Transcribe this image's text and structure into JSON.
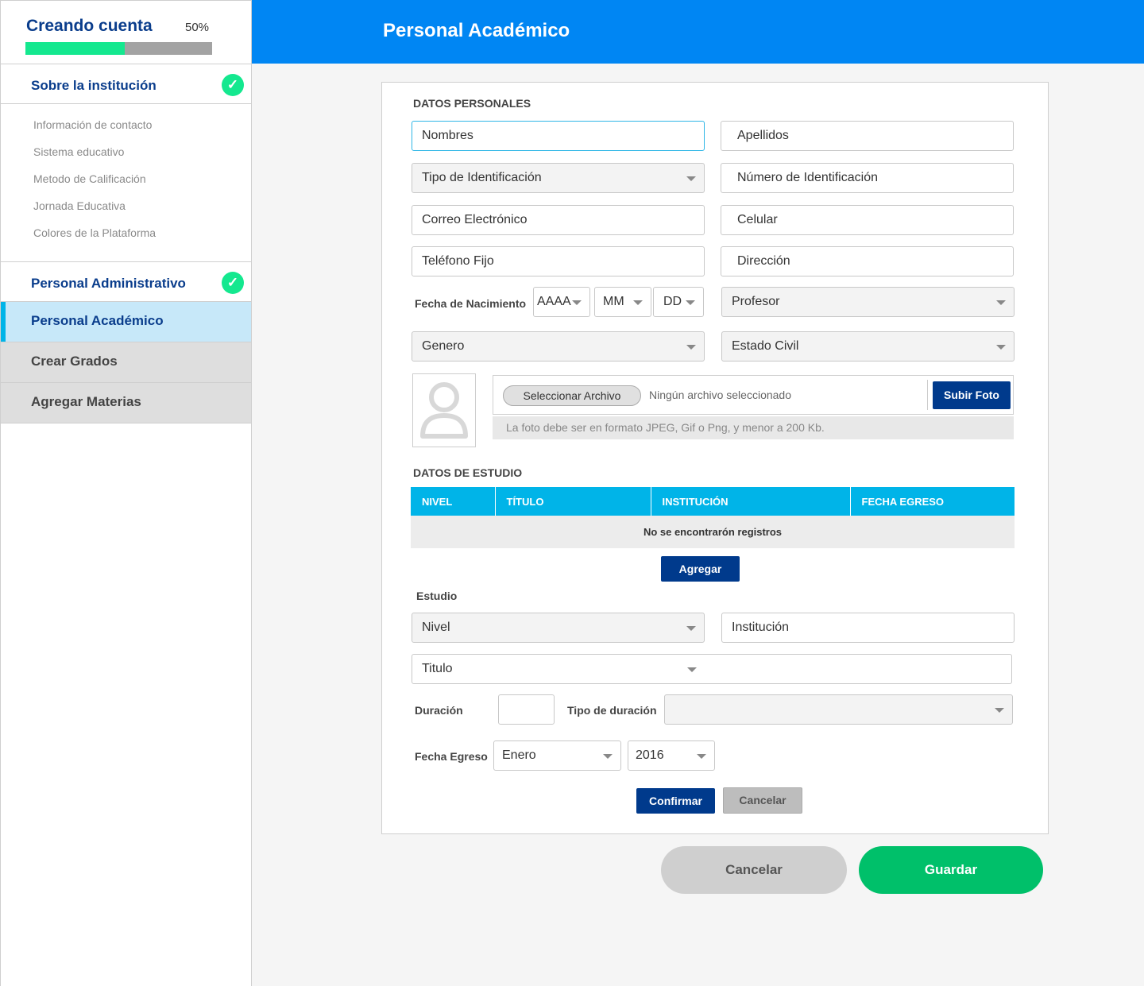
{
  "sidebar": {
    "title": "Creando cuenta",
    "progress_text": "50%",
    "progress": 0.53,
    "section1": {
      "label": "Sobre la institución",
      "check": "✓"
    },
    "subitems": [
      "Información de contacto",
      "Sistema educativo",
      "Metodo de Calificación",
      "Jornada Educativa",
      "Colores de la Plataforma"
    ],
    "section2": {
      "label": "Personal Administrativo",
      "check": "✓"
    },
    "active": "Personal Académico",
    "grados": "Crear Grados",
    "materias": "Agregar Materias"
  },
  "header": {
    "title": "Personal Académico"
  },
  "personal": {
    "section_title": "DATOS PERSONALES",
    "nombres": "Nombres",
    "apellidos": "Apellidos",
    "tipo_id": "Tipo de Identificación",
    "num_id": "Número de Identificación",
    "correo": "Correo Electrónico",
    "celular": "Celular",
    "telefono": "Teléfono Fijo",
    "direccion": "Dirección",
    "fecha_label": "Fecha de Nacimiento",
    "aaaa": "AAAA",
    "mm": "MM",
    "dd": "DD",
    "profesor": "Profesor",
    "genero": "Genero",
    "estado_civil": "Estado Civil",
    "file_button": "Seleccionar Archivo",
    "file_text": "Ningún archivo seleccionado",
    "upload_button": "Subir Foto",
    "file_hint": "La foto debe ser en formato  JPEG, Gif o Png, y menor a 200 Kb."
  },
  "estudio": {
    "section_title": "DATOS DE ESTUDIO",
    "columns": [
      "NIVEL",
      "TÍTULO",
      "INSTITUCIÓN",
      "FECHA EGRESO"
    ],
    "empty": "No se encontrarón registros",
    "agregar": "Agregar",
    "sub_title": "Estudio",
    "nivel": "Nivel",
    "institucion": "Institución",
    "titulo": "Titulo",
    "duracion_label": "Duración",
    "duracion_value": "",
    "tipo_duracion_label": "Tipo de duración",
    "tipo_duracion_value": "",
    "egreso_label": "Fecha Egreso",
    "mes": "Enero",
    "anio": "2016",
    "confirmar": "Confirmar",
    "cancelar": "Cancelar"
  },
  "footer": {
    "cancelar": "Cancelar",
    "guardar": "Guardar"
  },
  "colors": {
    "header": "#0086f3",
    "accent": "#00b4e8",
    "primary_dark": "#003a8c",
    "success": "#14e88f",
    "save": "#00c06a"
  }
}
